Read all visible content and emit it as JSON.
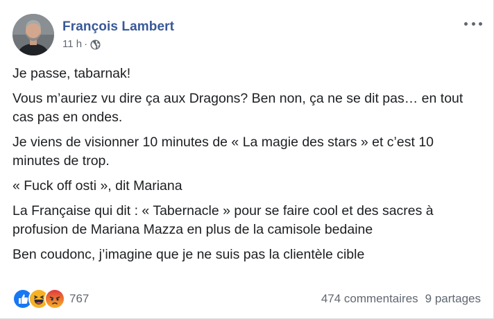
{
  "post": {
    "author": "François Lambert",
    "time": "11 h",
    "separator": "·",
    "paragraphs": [
      "Je passe, tabarnak!",
      "Vous m’auriez vu dire ça aux Dragons? Ben non, ça ne se dit pas… en tout cas pas en ondes.",
      "Je viens de visionner 10 minutes de « La magie des stars » et c’est 10 minutes de trop.",
      "« Fuck off osti », dit Mariana",
      "La Française qui dit : « Tabernacle » pour se faire cool et des sacres à profusion de Mariana Mazza en plus de la camisole bedaine",
      "Ben coudonc, j’imagine que je ne suis pas la clientèle cible"
    ],
    "audience_icon": "globe-icon",
    "more_icon": "more-options-icon"
  },
  "footer": {
    "reactions": [
      "like",
      "haha",
      "angry"
    ],
    "reaction_count": "767",
    "comments": "474 commentaires",
    "shares": "9 partages"
  },
  "colors": {
    "author": "#385898",
    "secondary_text": "#616770",
    "like": "#1877f2",
    "haha": "#f7b125",
    "angry": "#e9710f"
  }
}
